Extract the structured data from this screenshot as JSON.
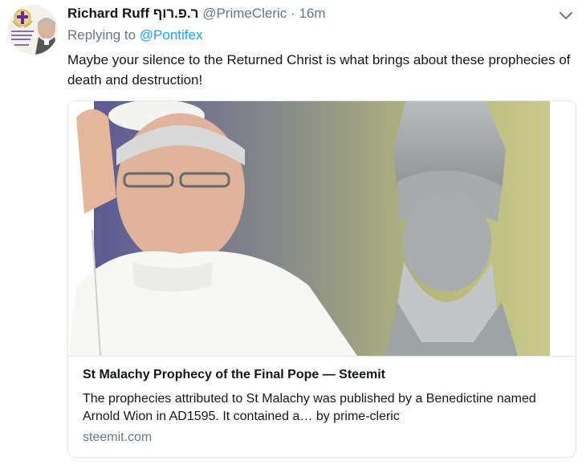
{
  "tweet": {
    "avatar_icon": "prime-cleric-avatar-icon",
    "name": "Richard Ruff ר.פ.רוף",
    "handle": "@PrimeCleric",
    "separator": "·",
    "time": "16m",
    "menu_icon": "chevron-down-icon",
    "replying_label": "Replying to",
    "replying_to": "@Pontifex",
    "text": "Maybe your silence to the Returned Christ is what brings about these prophecies of death and destruction!"
  },
  "card": {
    "image": "pope-and-st-malachy-statue-image",
    "title": "St Malachy Prophecy of the Final Pope — Steemit",
    "description": "The prophecies attributed to St Malachy was published by a Benedictine named Arnold Wion in AD1595. It contained a… by prime-cleric",
    "domain": "steemit.com"
  },
  "colors": {
    "name": "#14171a",
    "secondary": "#657786",
    "link": "#1da1f2",
    "border": "#e1e8ed"
  }
}
